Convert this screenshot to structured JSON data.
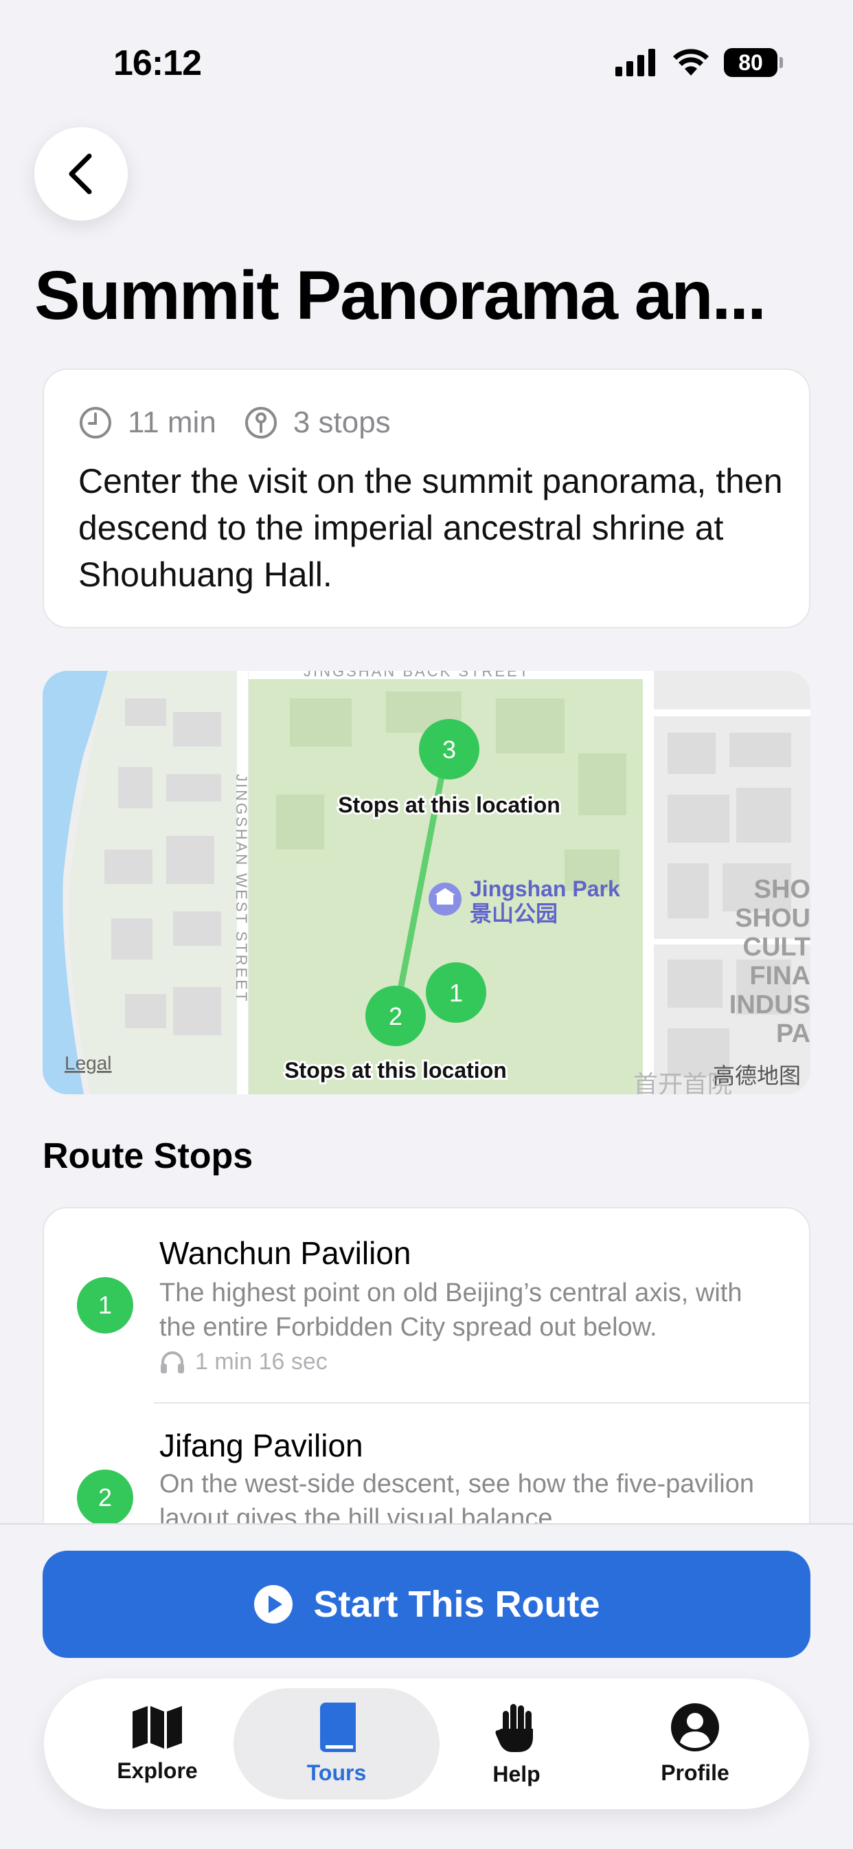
{
  "status": {
    "time": "16:12",
    "battery": "80"
  },
  "title": "Summit Panorama an...",
  "info": {
    "duration": "11 min",
    "stops_count": "3 stops",
    "description": "Center the visit on the summit panorama, then descend to the imperial ancestral shrine at Shouhuang Hall."
  },
  "map": {
    "street_top": "JINGSHAN BACK STREET",
    "street_west": "JINGSHAN WEST STREET",
    "park_name_en": "Jingshan Park",
    "park_name_cn": "景山公园",
    "callout_top": "Stops at this location",
    "callout_bottom": "Stops at this location",
    "pins": [
      "1",
      "2",
      "3"
    ],
    "legal": "Legal",
    "provider": "高德地图",
    "right_label": "SHO\nSHOU\nCULT\nFINA\nINDUS\nPA",
    "bottom_cn": "首开首院",
    "park_color": "#d6e8c6",
    "water_color": "#a9d6f5",
    "route_color": "#5fcf6f"
  },
  "route_stops": {
    "title": "Route Stops",
    "items": [
      {
        "num": "1",
        "title": "Wanchun Pavilion",
        "desc": "The highest point on old Beijing’s central axis, with the entire Forbidden City spread out below.",
        "audio": "1 min 16 sec"
      },
      {
        "num": "2",
        "title": "Jifang Pavilion",
        "desc": "On the west-side descent, see how the five-pavilion layout gives the hill visual balance."
      }
    ]
  },
  "start_button": {
    "label": "Start This Route"
  },
  "tabs": [
    {
      "label": "Explore",
      "icon": "map-icon"
    },
    {
      "label": "Tours",
      "icon": "book-icon",
      "active": true
    },
    {
      "label": "Help",
      "icon": "hand-icon"
    },
    {
      "label": "Profile",
      "icon": "person-icon"
    }
  ],
  "colors": {
    "accent": "#2a6edb",
    "stop_green": "#34c759"
  }
}
